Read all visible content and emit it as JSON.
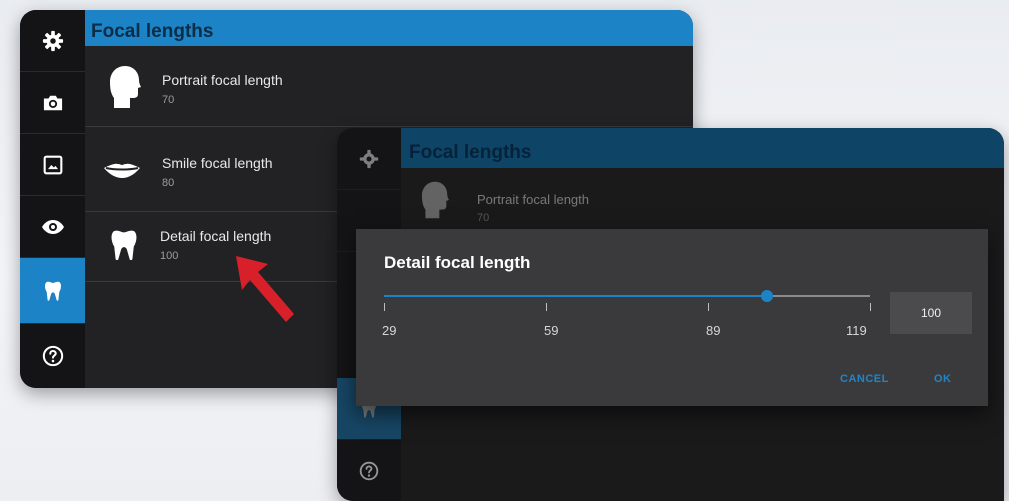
{
  "screen1": {
    "title": "Focal lengths",
    "sidebar": [
      {
        "icon": "gear-icon"
      },
      {
        "icon": "camera-icon"
      },
      {
        "icon": "image-icon"
      },
      {
        "icon": "eye-icon"
      },
      {
        "icon": "tooth-icon",
        "active": true
      },
      {
        "icon": "help-icon"
      }
    ],
    "items": [
      {
        "icon": "head-icon",
        "title": "Portrait focal length",
        "value": "70"
      },
      {
        "icon": "lips-icon",
        "title": "Smile focal length",
        "value": "80"
      },
      {
        "icon": "tooth-icon",
        "title": "Detail focal length",
        "value": "100"
      }
    ]
  },
  "screen2": {
    "title": "Focal lengths",
    "items": [
      {
        "icon": "head-icon",
        "title": "Portrait focal length",
        "value": "70"
      }
    ],
    "dialog": {
      "title": "Detail focal length",
      "slider": {
        "min": 29,
        "max": 119,
        "value": 100
      },
      "ticks": [
        "29",
        "59",
        "89",
        "119"
      ],
      "value_box": "100",
      "cancel_label": "CANCEL",
      "ok_label": "OK"
    }
  },
  "colors": {
    "accent": "#1c83c6",
    "pointer": "#d8202a",
    "panel": "#1f1f21"
  }
}
